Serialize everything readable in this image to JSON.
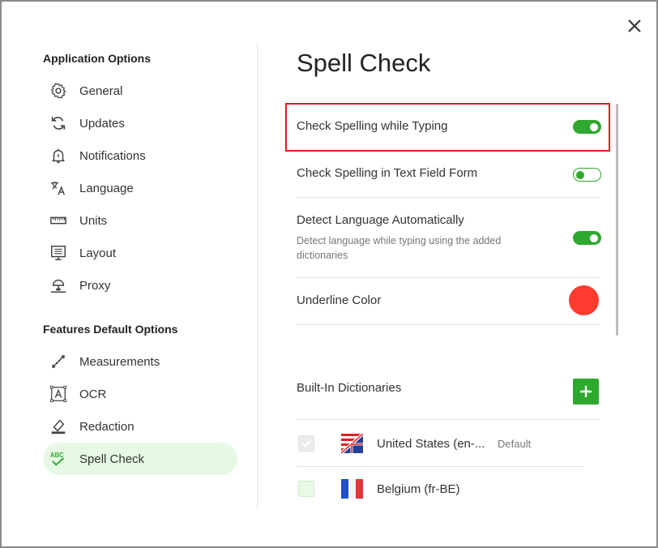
{
  "dialog": {
    "close_icon": "close-icon"
  },
  "sidebar": {
    "application_section_title": "Application Options",
    "application_items": [
      {
        "label": "General",
        "icon": "gear-icon"
      },
      {
        "label": "Updates",
        "icon": "refresh-icon"
      },
      {
        "label": "Notifications",
        "icon": "bell-icon"
      },
      {
        "label": "Language",
        "icon": "translate-icon"
      },
      {
        "label": "Units",
        "icon": "ruler-icon"
      },
      {
        "label": "Layout",
        "icon": "layout-icon"
      },
      {
        "label": "Proxy",
        "icon": "network-icon"
      }
    ],
    "features_section_title": "Features Default Options",
    "features_items": [
      {
        "label": "Measurements",
        "icon": "measure-icon"
      },
      {
        "label": "OCR",
        "icon": "ocr-icon"
      },
      {
        "label": "Redaction",
        "icon": "eraser-icon"
      },
      {
        "label": "Spell Check",
        "icon": "spellcheck-icon",
        "active": true
      }
    ]
  },
  "main": {
    "title": "Spell Check",
    "settings": [
      {
        "label": "Check Spelling while Typing",
        "enabled": true
      },
      {
        "label": "Check Spelling in Text Field Form",
        "enabled": false
      },
      {
        "label": "Detect Language Automatically",
        "description": "Detect language while typing using the added dictionaries",
        "enabled": true
      },
      {
        "label": "Underline Color",
        "color": "#ff3b30"
      }
    ],
    "dictionaries_title": "Built-In Dictionaries",
    "add_icon": "plus-icon",
    "dictionaries": [
      {
        "name": "United States (en-...",
        "badge": "Default",
        "flag": "us-uk-flag-icon",
        "checked": true,
        "disabled": true
      },
      {
        "name": "Belgium (fr-BE)",
        "flag": "france-flag-icon",
        "checked": false
      }
    ]
  },
  "colors": {
    "accent": "#2ea82e",
    "highlight": "#e01b24",
    "active_nav_bg": "#e6f9e4",
    "underline": "#ff3b30"
  }
}
